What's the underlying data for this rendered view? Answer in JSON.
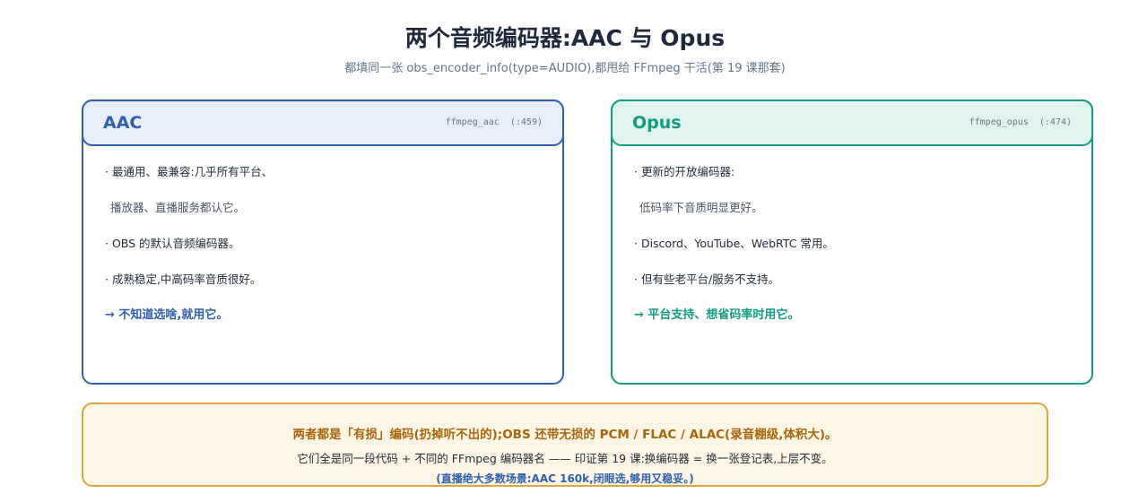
{
  "header": {
    "title": "两个音频编码器:AAC 与 Opus",
    "subtitle": "都填同一张 obs_encoder_info(type=AUDIO),都甩给 FFmpeg 干活(第 19 课那套)"
  },
  "cards": [
    {
      "name": "AAC",
      "code": "ffmpeg_aac  (:459)",
      "lines": [
        "· 最通用、最兼容:几乎所有平台、",
        "播放器、直播服务都认它。",
        "· OBS 的默认音频编码器。",
        "· 成熟稳定,中高码率音质很好。"
      ],
      "conclusion": "→ 不知道选啥,就用它。",
      "color": "#2f5fb0"
    },
    {
      "name": "Opus",
      "code": "ffmpeg_opus  (:474)",
      "lines": [
        "· 更新的开放编码器:",
        "低码率下音质明显更好。",
        "· Discord、YouTube、WebRTC 常用。",
        "· 但有些老平台/服务不支持。"
      ],
      "conclusion": "→ 平台支持、想省码率时用它。",
      "color": "#159a84"
    }
  ],
  "note": {
    "main": "两者都是「有损」编码(扔掉听不出的);OBS 还带无损的 PCM / FLAC / ALAC(录音棚级,体积大)。",
    "sub": "它们全是同一段代码 + 不同的 FFmpeg 编码器名 —— 印证第 19 课:换编码器 = 换一张登记表,上层不变。",
    "emphasis": "(直播绝大多数场景:AAC 160k,闭眼选,够用又稳妥。)"
  }
}
